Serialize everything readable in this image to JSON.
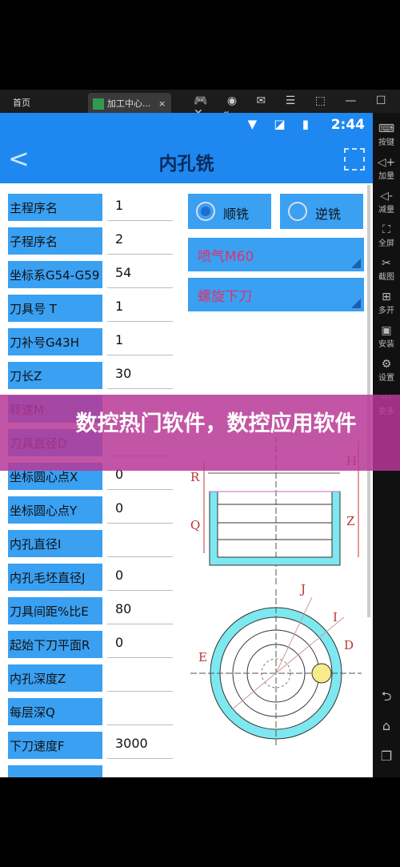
{
  "window": {
    "home_label": "首页",
    "tab_label": "加工中心...",
    "tab_close": "×",
    "controls": "🎮 ◉ ✉ ☰ ⬚ — ☐ ✕ «"
  },
  "status": {
    "time": "2:44",
    "icons": "▼ ◪ ▮"
  },
  "appbar": {
    "title": "内孔铣",
    "back": "<"
  },
  "fields": [
    {
      "label": "主程序名",
      "value": "1"
    },
    {
      "label": "子程序名",
      "value": "2"
    },
    {
      "label": "坐标系G54-G59",
      "value": "54"
    },
    {
      "label": "刀具号 T",
      "value": "1"
    },
    {
      "label": "刀补号G43H",
      "value": "1"
    },
    {
      "label": "刀长Z",
      "value": "30"
    },
    {
      "label": "转速M",
      "value": ""
    },
    {
      "label": "刀具直径D",
      "value": ""
    },
    {
      "label": "坐标圆心点X",
      "value": "0"
    },
    {
      "label": "坐标圆心点Y",
      "value": "0"
    },
    {
      "label": "内孔直径I",
      "value": ""
    },
    {
      "label": "内孔毛坯直径J",
      "value": "0"
    },
    {
      "label": "刀具间距%比E",
      "value": "80"
    },
    {
      "label": "起始下刀平面R",
      "value": "0"
    },
    {
      "label": "内孔深度Z",
      "value": ""
    },
    {
      "label": "每层深Q",
      "value": ""
    },
    {
      "label": "下刀速度F",
      "value": "3000"
    },
    {
      "label": "",
      "value": ""
    }
  ],
  "milling": {
    "climb": "顺铣",
    "conventional": "逆铣",
    "selected": "climb"
  },
  "dropdowns": [
    {
      "value": "喷气M60"
    },
    {
      "value": "螺旋下刀"
    }
  ],
  "diagram": {
    "labels": [
      "R",
      "Q",
      "H",
      "Z",
      "J",
      "I",
      "D",
      "E"
    ]
  },
  "sidebar": [
    {
      "icon": "⌨",
      "label": "按键"
    },
    {
      "icon": "◁+",
      "label": "加量"
    },
    {
      "icon": "◁-",
      "label": "减量"
    },
    {
      "icon": "⛶",
      "label": "全屏"
    },
    {
      "icon": "✂",
      "label": "截图"
    },
    {
      "icon": "⊞",
      "label": "多开"
    },
    {
      "icon": "▣",
      "label": "安装"
    },
    {
      "icon": "⚙",
      "label": "设置"
    },
    {
      "icon": "⋯",
      "label": "更多"
    }
  ],
  "sidebar_nav": [
    "⮌",
    "⌂",
    "❐"
  ],
  "banner": {
    "text": "数控热门软件，数控应用软件"
  }
}
